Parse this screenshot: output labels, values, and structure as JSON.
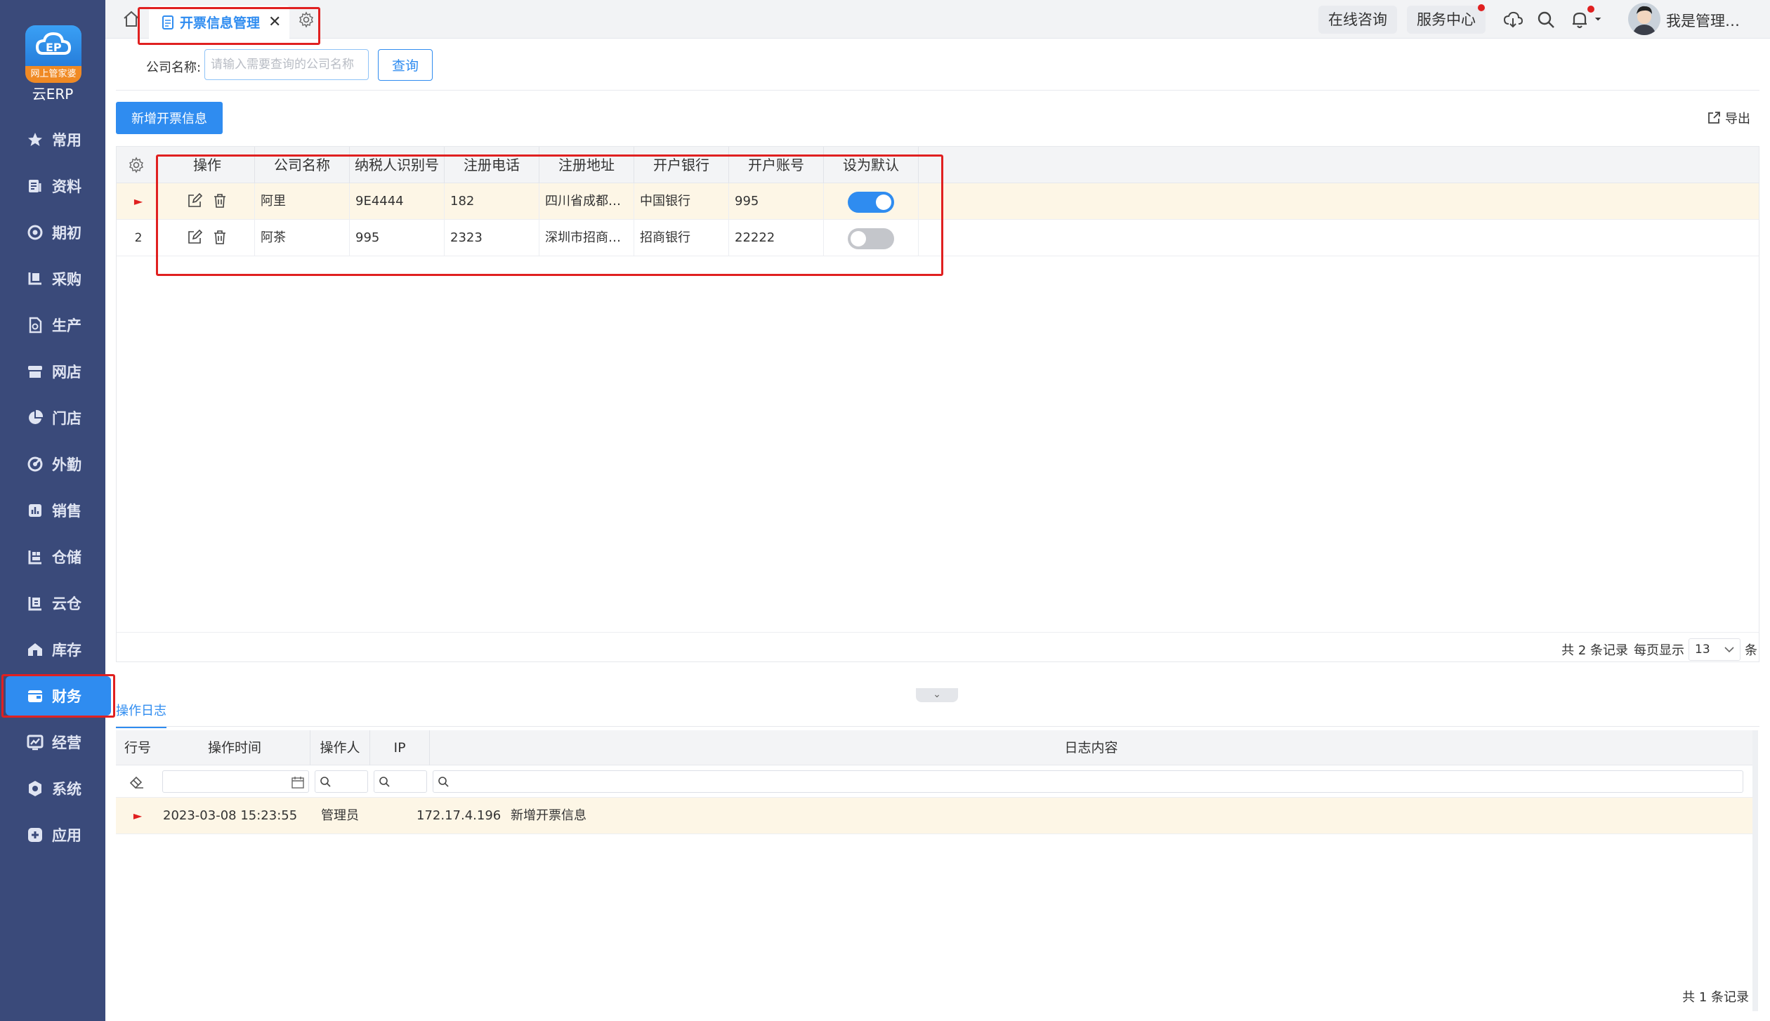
{
  "brand": {
    "logo_ribbon": "网上管家婆",
    "logo_text": "云ERP"
  },
  "sidebar": {
    "items": [
      {
        "label": "常用",
        "icon": "star-icon"
      },
      {
        "label": "资料",
        "icon": "document-icon"
      },
      {
        "label": "期初",
        "icon": "target-icon"
      },
      {
        "label": "采购",
        "icon": "purchase-icon"
      },
      {
        "label": "生产",
        "icon": "production-icon"
      },
      {
        "label": "网店",
        "icon": "store-icon"
      },
      {
        "label": "门店",
        "icon": "pie-icon"
      },
      {
        "label": "外勤",
        "icon": "field-icon"
      },
      {
        "label": "销售",
        "icon": "sales-chart-icon"
      },
      {
        "label": "仓储",
        "icon": "warehouse-icon"
      },
      {
        "label": "云仓",
        "icon": "cloud-warehouse-icon"
      },
      {
        "label": "库存",
        "icon": "house-icon"
      },
      {
        "label": "财务",
        "icon": "finance-icon",
        "active": true
      },
      {
        "label": "经营",
        "icon": "business-icon"
      },
      {
        "label": "系统",
        "icon": "system-icon"
      },
      {
        "label": "应用",
        "icon": "plus-app-icon"
      }
    ]
  },
  "topbar": {
    "tab_label": "开票信息管理",
    "tab_close": "✕",
    "online_consult": "在线咨询",
    "service_center": "服务中心",
    "user_name": "我是管理…"
  },
  "search": {
    "label": "公司名称:",
    "placeholder": "请输入需要查询的公司名称",
    "button": "查询"
  },
  "toolbar": {
    "add_button": "新增开票信息",
    "export_button": "导出"
  },
  "grid": {
    "columns": [
      "操作",
      "公司名称",
      "纳税人识别号",
      "注册电话",
      "注册地址",
      "开户银行",
      "开户账号",
      "设为默认"
    ],
    "rows": [
      {
        "marker": "►",
        "company": "阿里",
        "tax_id": "9E4444",
        "phone": "182",
        "address": "四川省成都…",
        "bank": "中国银行",
        "account": "995",
        "default": true
      },
      {
        "marker": "2",
        "company": "阿茶",
        "tax_id": "995",
        "phone": "2323",
        "address": "深圳市招商…",
        "bank": "招商银行",
        "account": "22222",
        "default": false
      }
    ],
    "footer": {
      "total_text": "共 2 条记录",
      "per_page_label": "每页显示",
      "page_size": "13",
      "unit": "条"
    }
  },
  "log": {
    "tab_label": "操作日志",
    "columns": [
      "行号",
      "操作时间",
      "操作人",
      "IP",
      "日志内容"
    ],
    "rows": [
      {
        "marker": "►",
        "time": "2023-03-08 15:23:55",
        "operator": "管理员",
        "ip": "172.17.4.196",
        "content": "新增开票信息"
      }
    ],
    "footer_text": "共 1 条记录"
  },
  "colors": {
    "accent": "#2f8cf0",
    "sidebar": "#3a4a7a",
    "highlight": "#e02020",
    "selected_row": "#fdf6e6"
  }
}
